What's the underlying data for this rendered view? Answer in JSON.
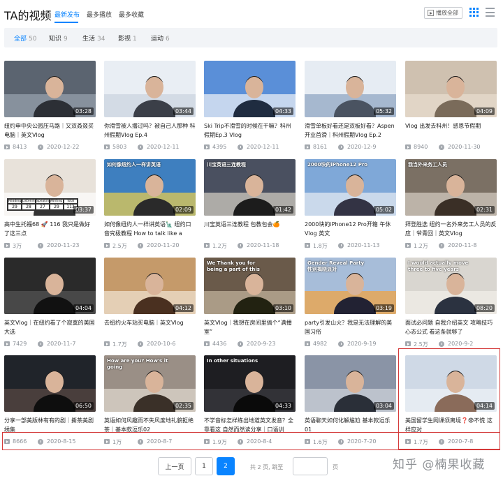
{
  "header": {
    "title": "TA的视频",
    "tabs": [
      {
        "label": "最新发布",
        "active": true
      },
      {
        "label": "最多播放",
        "active": false
      },
      {
        "label": "最多收藏",
        "active": false
      }
    ],
    "play_all_label": "播放全部",
    "accent_color": "#0a84ff"
  },
  "filters": [
    {
      "label": "全部",
      "count": "50",
      "active": true
    },
    {
      "label": "知识",
      "count": "9",
      "active": false
    },
    {
      "label": "生活",
      "count": "34",
      "active": false
    },
    {
      "label": "影视",
      "count": "1",
      "active": false
    },
    {
      "label": "运动",
      "count": "6",
      "active": false
    }
  ],
  "videos": [
    {
      "duration": "03:28",
      "title": "纽约申中央公园压马路｜又双叒叕买电脑｜英文Vlog",
      "views": "8413",
      "date": "2020-12-22"
    },
    {
      "duration": "03:44",
      "title": "你滑雪被人撂过吗？被自己人那种 科州假期Vlog Ep.4",
      "views": "5803",
      "date": "2020-12-11"
    },
    {
      "duration": "04:33",
      "title": "Ski Trip不滑雪的时候在干嘛？科州假期Ep.3 Vlog",
      "views": "4395",
      "date": "2020-12-11"
    },
    {
      "duration": "05:32",
      "title": "滑雪单板好看还是双板好看？Aspen开业首滑｜科州假期Vlog Ep.2",
      "views": "8161",
      "date": "2020-12-9"
    },
    {
      "duration": "04:09",
      "title": "Vlog 出发去科州！感恩节假期",
      "views": "8940",
      "date": "2020-11-30"
    },
    {
      "duration": "03:37",
      "title": "高中生托福68 🚀 116 我只是做好了这三点",
      "views": "3万",
      "date": "2020-11-23"
    },
    {
      "duration": "02:09",
      "title": "如何像纽约人一样讲英语🗽 纽约口音究极教程 How to talk like a",
      "views": "2.5万",
      "date": "2020-11-20"
    },
    {
      "duration": "01:42",
      "title": "川宝英语三连教程 包教包会🍊",
      "views": "1.2万",
      "date": "2020-11-18"
    },
    {
      "duration": "05:02",
      "title": "2000块的iPhone12 Pro开箱 午休Vlog 英文",
      "views": "1.8万",
      "date": "2020-11-13"
    },
    {
      "duration": "02:31",
      "title": "拜登胜选 纽约一名外来务工人员的反应｜爷青回｜英文Vlog",
      "views": "1.2万",
      "date": "2020-11-8"
    },
    {
      "duration": "04:04",
      "title": "英文Vlog｜在纽约看了个寂寞的美国大选",
      "views": "7429",
      "date": "2020-11-7"
    },
    {
      "duration": "04:12",
      "title": "去纽约火车站买电脑｜英文Vlog",
      "views": "1.7万",
      "date": "2020-10-6"
    },
    {
      "duration": "03:10",
      "title": "英文Vlog｜我想在房间里搞个“满播室”",
      "views": "4436",
      "date": "2020-9-23"
    },
    {
      "duration": "03:19",
      "title": "party引发山火？我是无法理解的美国习俗",
      "views": "4982",
      "date": "2020-9-19"
    },
    {
      "duration": "08:20",
      "title": "面试必问题 自我介绍英文 攻略技巧 心态公式 看这条就够了",
      "views": "2.5万",
      "date": "2020-9-2"
    },
    {
      "duration": "06:50",
      "title": "分享一部美版林有有的剧｜撕茶美剧绣集",
      "views": "8666",
      "date": "2020-8-15"
    },
    {
      "duration": "02:35",
      "title": "英语如何风趣而不失风度地礼貌拒绝 茶｜基本款逗乐02",
      "views": "1万",
      "date": "2020-8-7"
    },
    {
      "duration": "04:33",
      "title": "不学音标怎样练出地道英文发音？全靠看这 自然而然读分享｜口语训",
      "views": "1.9万",
      "date": "2020-8-4"
    },
    {
      "duration": "03:04",
      "title": "英语聊天如何化解尴尬 基本款逗乐01",
      "views": "1.6万",
      "date": "2020-7-20"
    },
    {
      "duration": "04:14",
      "title": "美国留学生网课须离境❓😨不慌 这样应对",
      "views": "1.7万",
      "date": "2020-7-8"
    }
  ],
  "thumbs": [
    {
      "text": ""
    },
    {
      "text": ""
    },
    {
      "text": ""
    },
    {
      "text": ""
    },
    {
      "text": ""
    },
    {
      "text": "",
      "table": [
        "Reading",
        "Listening",
        "Speaking",
        "Writing",
        "Total"
      ],
      "scores": [
        "29",
        "28",
        "27",
        "29",
        "113"
      ]
    },
    {
      "text": "如何像纽约人一样讲英语"
    },
    {
      "text": "川宝英语三连教程"
    },
    {
      "text": "2000块的iPhone12 Pro"
    },
    {
      "text": "我当外来务工人员"
    },
    {
      "text": ""
    },
    {
      "text": ""
    },
    {
      "text": "We Thank you for being a part of this"
    },
    {
      "text": "Gender Reveal Party 性别揭晓派对"
    },
    {
      "text": "I would actually move three to five years"
    },
    {
      "text": ""
    },
    {
      "text": "How are you? How's it going"
    },
    {
      "text": "In other situations"
    },
    {
      "text": ""
    },
    {
      "text": ""
    }
  ],
  "pagination": {
    "prev_label": "上一页",
    "pages": [
      "1",
      "2"
    ],
    "current": "2",
    "total_text": "共 2 页, 跳至",
    "page_suffix": "页"
  },
  "watermark": "知乎 @楠果收藏",
  "highlight_color": "#d43a3a"
}
